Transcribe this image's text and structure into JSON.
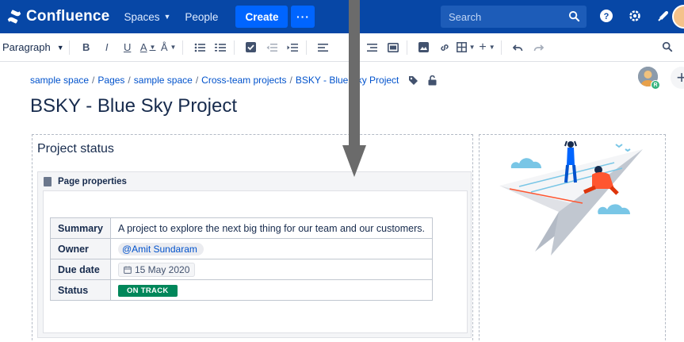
{
  "app": {
    "name": "Confluence",
    "nav": [
      "Spaces",
      "People"
    ],
    "create_label": "Create",
    "more_label": "···",
    "search_placeholder": "Search",
    "colors": {
      "nav_bg": "#0747a6",
      "create_bg": "#0065ff",
      "status_green": "#00875a"
    }
  },
  "toolbar": {
    "paragraph_style": "Paragraph",
    "bold": "B",
    "italic": "I",
    "underline": "U",
    "text_color": "A",
    "icons": [
      "bold-icon",
      "italic-icon",
      "underline-icon",
      "text-color-icon",
      "text-formatting-icon",
      "bullet-list-icon",
      "numbered-list-icon",
      "task-icon",
      "outdent-icon",
      "indent-icon",
      "align-left-icon",
      "align-right-icon",
      "layout-icon",
      "image-icon",
      "link-icon",
      "table-icon",
      "insert-icon",
      "undo-icon",
      "redo-icon",
      "find-icon"
    ]
  },
  "breadcrumb": [
    "sample space",
    "Pages",
    "sample space",
    "Cross-team projects",
    "BSKY - Blue Sky Project"
  ],
  "page": {
    "title": "BSKY - Blue Sky Project",
    "avatar_badge": "R"
  },
  "project_status": {
    "heading": "Project status",
    "macro_title": "Page properties",
    "rows": [
      {
        "key": "Summary",
        "value": "A project to explore the next big thing for our team and our customers."
      },
      {
        "key": "Owner",
        "value": "@Amit Sundaram"
      },
      {
        "key": "Due date",
        "value": "15 May 2020"
      },
      {
        "key": "Status",
        "value": "ON TRACK"
      }
    ]
  }
}
